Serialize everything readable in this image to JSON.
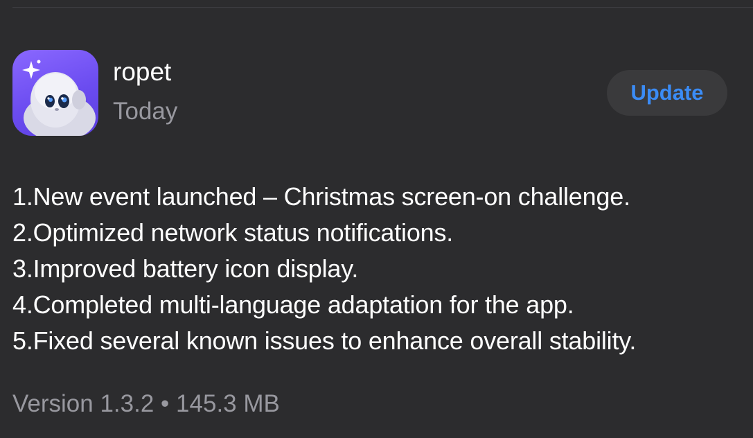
{
  "app": {
    "name": "ropet",
    "date": "Today",
    "update_label": "Update",
    "icon": "ropet-app-icon"
  },
  "release_notes": [
    "1.New event launched – Christmas screen-on challenge.",
    "2.Optimized network status notifications.",
    "3.Improved battery icon display.",
    "4.Completed multi-language adaptation for the app.",
    "5.Fixed several known issues to enhance overall stability."
  ],
  "footer": {
    "version": "Version 1.3.2",
    "separator": "•",
    "size": "145.3 MB"
  },
  "colors": {
    "background": "#2c2c2e",
    "accent": "#3b8cf6",
    "secondary_text": "#98989f",
    "button_bg": "#3a3a3c"
  }
}
